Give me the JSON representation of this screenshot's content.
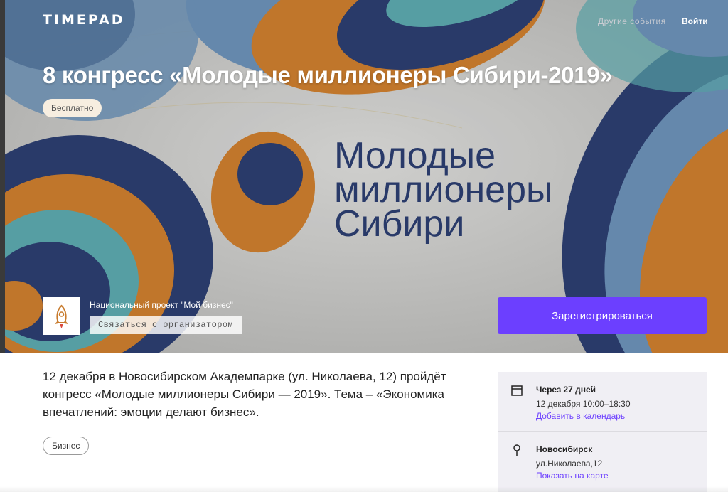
{
  "header": {
    "logo_text": "TIMEPAD",
    "nav": {
      "other_events": "Другие события",
      "login": "Войти"
    }
  },
  "event": {
    "title": "8 конгресс «Молодые миллионеры Сибири-2019»",
    "price_badge": "Бесплатно",
    "poster_lines": [
      "Молодые",
      "миллионеры",
      "Сибири"
    ]
  },
  "organizer": {
    "name": "Национальный проект \"Мой бизнес\"",
    "contact_label": "Связаться с организатором"
  },
  "register_label": "Зарегистрироваться",
  "description": "12 декабря в Новосибирском Академпарке (ул. Николаева, 12) пройдёт конгресс «Молодые миллионеры Сибири — 2019». Тема – «Экономика впечатлений: эмоции делают бизнес».",
  "tags": [
    "Бизнес"
  ],
  "info": {
    "date": {
      "title": "Через 27 дней",
      "time": "12 декабря 10:00–18:30",
      "link": "Добавить в календарь",
      "icon": "calendar-icon"
    },
    "place": {
      "title": "Новосибирск",
      "address": "ул.Николаева,12",
      "link": "Показать на карте",
      "icon": "location-pin-icon"
    }
  },
  "colors": {
    "accent": "#6c3fff",
    "poster_orange": "#c87b2d",
    "poster_navy": "#2b3d6e",
    "poster_blue": "#6a8eb3",
    "poster_teal": "#5aa5aa"
  }
}
